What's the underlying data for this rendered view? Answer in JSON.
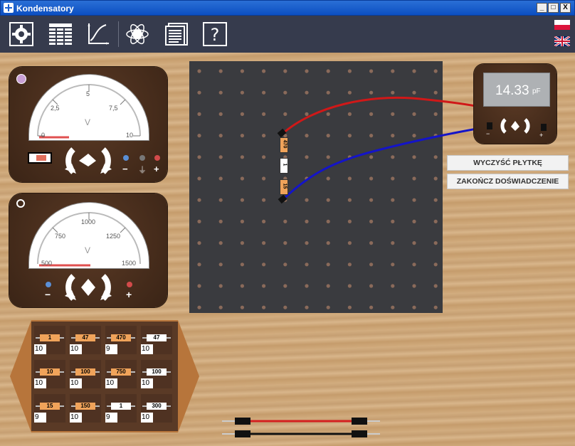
{
  "window": {
    "title": "Kondensatory",
    "controls": {
      "minimize": "_",
      "maximize": "□",
      "close": "X"
    }
  },
  "toolbar": {
    "icons": [
      "gear-icon",
      "table-icon",
      "graph-icon",
      "atom-icon",
      "document-icon",
      "help-icon"
    ],
    "help_label": "?"
  },
  "languages": [
    "Polski",
    "English"
  ],
  "voltmeter": {
    "unit": "V",
    "ticks": [
      "0",
      "2,5",
      "5",
      "7,5",
      "10"
    ],
    "terminals": [
      "−",
      "⏚",
      "+"
    ],
    "colors": {
      "minus": "#5a8fd6",
      "ground": "#777",
      "plus": "#d24a4a",
      "active_indicator": "#c9a0d6"
    }
  },
  "capmeter_gauge": {
    "unit": "V",
    "ticks": [
      "500",
      "750",
      "1000",
      "1250",
      "1500"
    ],
    "terminals": [
      "−",
      "+"
    ]
  },
  "digital_meter": {
    "value": "14.33",
    "unit": "pF",
    "terminals": [
      "−",
      "+"
    ]
  },
  "buttons": {
    "clear": "WYCZYŚĆ PŁYTKĘ",
    "finish": "ZAKOŃCZ DOŚWIADCZENIE"
  },
  "board_components": [
    {
      "label": "470",
      "color": "#f0a35a"
    },
    {
      "label": "1",
      "color": "#ffffff"
    },
    {
      "label": "15",
      "color": "#f0a35a"
    }
  ],
  "tray": {
    "items": [
      {
        "label": "1",
        "count": "10",
        "color": "#f0a35a"
      },
      {
        "label": "47",
        "count": "10",
        "color": "#f0a35a"
      },
      {
        "label": "470",
        "count": "9",
        "color": "#f0a35a"
      },
      {
        "label": "47",
        "count": "10",
        "color": "#ffffff"
      },
      {
        "label": "10",
        "count": "10",
        "color": "#f0a35a"
      },
      {
        "label": "100",
        "count": "10",
        "color": "#f0a35a"
      },
      {
        "label": "750",
        "count": "10",
        "color": "#f0a35a"
      },
      {
        "label": "100",
        "count": "10",
        "color": "#ffffff"
      },
      {
        "label": "15",
        "count": "9",
        "color": "#f0a35a"
      },
      {
        "label": "150",
        "count": "10",
        "color": "#f0a35a"
      },
      {
        "label": "1",
        "count": "9",
        "color": "#ffffff"
      },
      {
        "label": "300",
        "count": "10",
        "color": "#ffffff"
      }
    ]
  },
  "wires": [
    {
      "color": "#d42020"
    },
    {
      "color": "#111111"
    }
  ]
}
